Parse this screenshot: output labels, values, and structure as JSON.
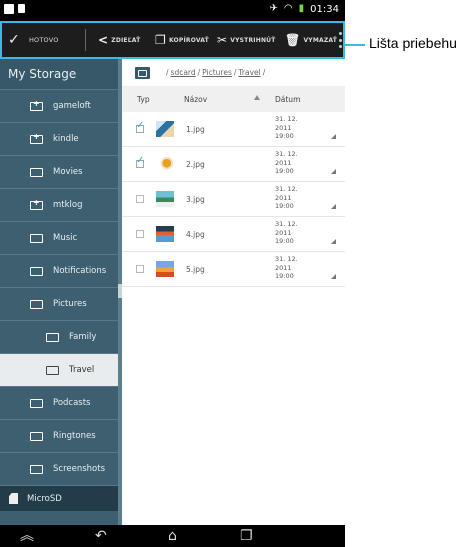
{
  "status_bar": {
    "time": "01:34",
    "icons": [
      "image-icon",
      "file-icon",
      "airplane-icon",
      "wifi-icon",
      "battery-icon"
    ]
  },
  "action_bar": {
    "done_label": "HOTOVO",
    "share_label": "ZDIEĽAŤ",
    "copy_label": "KOPÍROVAŤ",
    "cut_label": "VYSTRIHNÚŤ",
    "delete_label": "VYMAZAŤ",
    "accent_color": "#39b9ea"
  },
  "callout": {
    "label": "Lišta priebehu"
  },
  "sidebar": {
    "header": "My Storage",
    "items": [
      {
        "label": "gameloft"
      },
      {
        "label": "kindle"
      },
      {
        "label": "Movies"
      },
      {
        "label": "mtklog"
      },
      {
        "label": "Music"
      },
      {
        "label": "Notifications"
      },
      {
        "label": "Pictures"
      },
      {
        "label": "Family"
      },
      {
        "label": "Travel"
      },
      {
        "label": "Podcasts"
      },
      {
        "label": "Ringtones"
      },
      {
        "label": "Screenshots"
      },
      {
        "label": "MicroSD"
      }
    ]
  },
  "breadcrumb": {
    "sep": "/",
    "parts": [
      "sdcard",
      "Pictures",
      "Travel"
    ]
  },
  "columns": {
    "type": "Typ",
    "name": "Názov",
    "date": "Dátum"
  },
  "files": [
    {
      "name": "1.jpg",
      "date": "31. 12.\n2011\n19:00",
      "checked": true
    },
    {
      "name": "2.jpg",
      "date": "31. 12.\n2011\n19:00",
      "checked": true
    },
    {
      "name": "3.jpg",
      "date": "31. 12.\n2011\n19:00",
      "checked": false
    },
    {
      "name": "4.jpg",
      "date": "31. 12.\n2011\n19:00",
      "checked": false
    },
    {
      "name": "5.jpg",
      "date": "31. 12.\n2011\n19:00",
      "checked": false
    }
  ],
  "nav_bar": {
    "icons": [
      "back-icon",
      "home-icon",
      "recent-apps-icon",
      "collapse-icon"
    ]
  }
}
